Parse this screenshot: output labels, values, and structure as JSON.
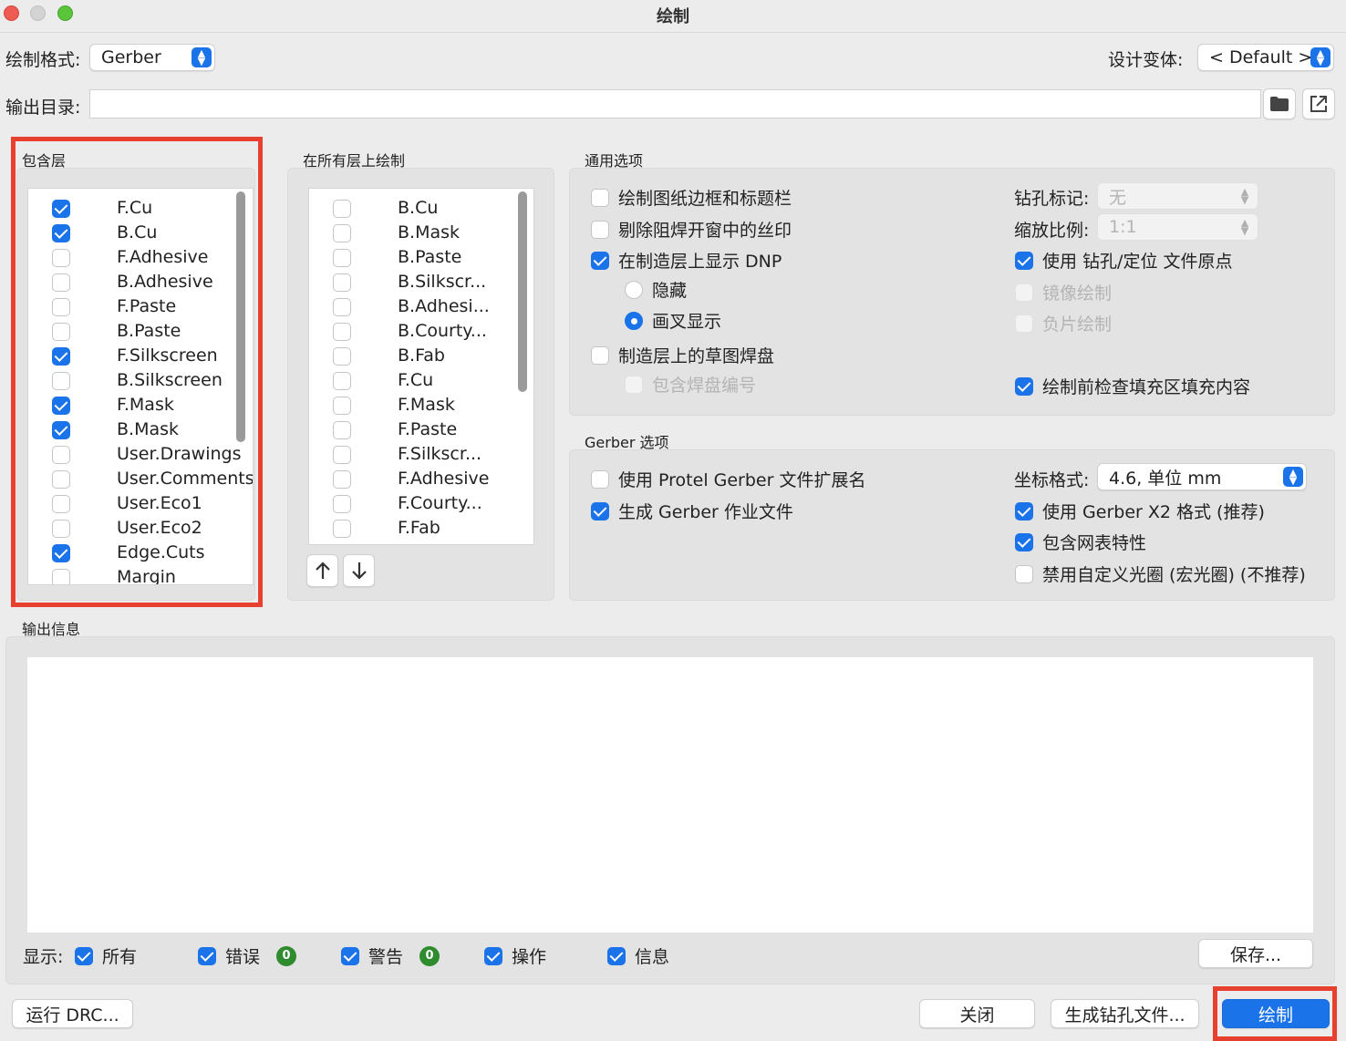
{
  "window": {
    "title": "绘制"
  },
  "top": {
    "format_label": "绘制格式:",
    "format_value": "Gerber",
    "variant_label": "设计变体:",
    "variant_value": "< Default >",
    "outdir_label": "输出目录:",
    "outdir_value": ""
  },
  "include_layers": {
    "title": "包含层",
    "items": [
      {
        "label": "F.Cu",
        "checked": true
      },
      {
        "label": "B.Cu",
        "checked": true
      },
      {
        "label": "F.Adhesive",
        "checked": false
      },
      {
        "label": "B.Adhesive",
        "checked": false
      },
      {
        "label": "F.Paste",
        "checked": false
      },
      {
        "label": "B.Paste",
        "checked": false
      },
      {
        "label": "F.Silkscreen",
        "checked": true
      },
      {
        "label": "B.Silkscreen",
        "checked": false
      },
      {
        "label": "F.Mask",
        "checked": true
      },
      {
        "label": "B.Mask",
        "checked": true
      },
      {
        "label": "User.Drawings",
        "checked": false
      },
      {
        "label": "User.Comments",
        "checked": false
      },
      {
        "label": "User.Eco1",
        "checked": false
      },
      {
        "label": "User.Eco2",
        "checked": false
      },
      {
        "label": "Edge.Cuts",
        "checked": true
      },
      {
        "label": "Margin",
        "checked": false
      }
    ]
  },
  "all_layers": {
    "title": "在所有层上绘制",
    "items": [
      {
        "label": "B.Cu",
        "checked": false
      },
      {
        "label": "B.Mask",
        "checked": false
      },
      {
        "label": "B.Paste",
        "checked": false
      },
      {
        "label": "B.Silkscr...",
        "checked": false
      },
      {
        "label": "B.Adhesi...",
        "checked": false
      },
      {
        "label": "B.Courty...",
        "checked": false
      },
      {
        "label": "B.Fab",
        "checked": false
      },
      {
        "label": "F.Cu",
        "checked": false
      },
      {
        "label": "F.Mask",
        "checked": false
      },
      {
        "label": "F.Paste",
        "checked": false
      },
      {
        "label": "F.Silkscr...",
        "checked": false
      },
      {
        "label": "F.Adhesive",
        "checked": false
      },
      {
        "label": "F.Courty...",
        "checked": false
      },
      {
        "label": "F.Fab",
        "checked": false
      }
    ],
    "up_icon": "arrow-up-icon",
    "down_icon": "arrow-down-icon"
  },
  "general": {
    "title": "通用选项",
    "border_title": "绘制图纸边框和标题栏",
    "remove_silk": "剔除阻焊开窗中的丝印",
    "show_dnp": "在制造层上显示 DNP",
    "hide": "隐藏",
    "cross": "画叉显示",
    "sketch_pads": "制造层上的草图焊盘",
    "include_pad_num": "包含焊盘编号",
    "drill_marks_label": "钻孔标记:",
    "drill_marks_value": "无",
    "scale_label": "缩放比例:",
    "scale_value": "1:1",
    "use_drill_origin": "使用 钻孔/定位 文件原点",
    "mirror": "镜像绘制",
    "negative": "负片绘制",
    "check_zone": "绘制前检查填充区填充内容"
  },
  "gerber": {
    "title": "Gerber 选项",
    "protel_ext": "使用 Protel Gerber 文件扩展名",
    "job_file": "生成 Gerber 作业文件",
    "coord_label": "坐标格式:",
    "coord_value": "4.6, 单位 mm",
    "x2": "使用 Gerber X2 格式 (推荐)",
    "netlist": "包含网表特性",
    "no_macro": "禁用自定义光圈 (宏光圈) (不推荐)"
  },
  "output": {
    "title": "输出信息",
    "show_label": "显示:",
    "all": "所有",
    "errors": "错误",
    "errors_count": "0",
    "warnings": "警告",
    "warnings_count": "0",
    "actions": "操作",
    "infos": "信息",
    "save": "保存..."
  },
  "footer": {
    "run_drc": "运行 DRC...",
    "close": "关闭",
    "gen_drill": "生成钻孔文件...",
    "plot": "绘制"
  },
  "colors": {
    "accent": "#1a73e8",
    "highlight": "#e8402e",
    "badge": "#2e8b2e"
  }
}
